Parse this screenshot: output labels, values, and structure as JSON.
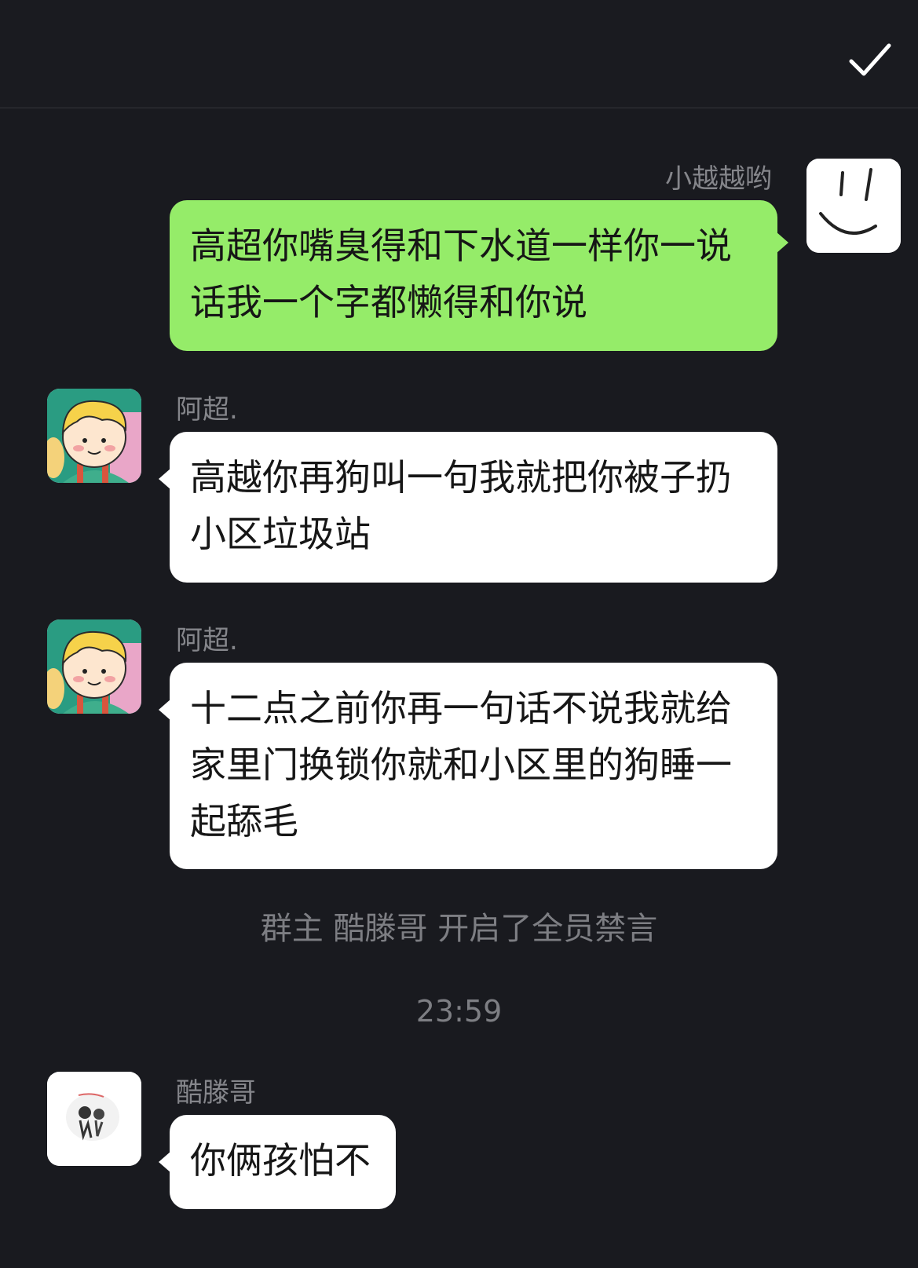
{
  "header": {
    "title": "",
    "confirm_icon": "checkmark-icon"
  },
  "messages": [
    {
      "sender": "小越越哟",
      "side": "right",
      "bubble_color": "#95ec69",
      "avatar_icon": "smiley-face-avatar",
      "text": "高超你嘴臭得和下水道一样你一说话我一个字都懒得和你说"
    },
    {
      "sender": "阿超.",
      "side": "left",
      "bubble_color": "#ffffff",
      "avatar_icon": "cartoon-kid-avatar",
      "text": "高越你再狗叫一句我就把你被子扔小区垃圾站"
    },
    {
      "sender": "阿超.",
      "side": "left",
      "bubble_color": "#ffffff",
      "avatar_icon": "cartoon-kid-avatar",
      "text": "十二点之前你再一句话不说我就给家里门换锁你就和小区里的狗睡一起舔毛"
    },
    {
      "sender": "酷滕哥",
      "side": "left",
      "bubble_color": "#ffffff",
      "avatar_icon": "sketch-figures-avatar",
      "text": "你俩孩怕不"
    }
  ],
  "system_notice": "群主 酷滕哥 开启了全员禁言",
  "timestamp": "23:59",
  "colors": {
    "background": "#191a1f",
    "my_bubble": "#95ec69",
    "other_bubble": "#ffffff",
    "meta_text": "#85868b"
  }
}
